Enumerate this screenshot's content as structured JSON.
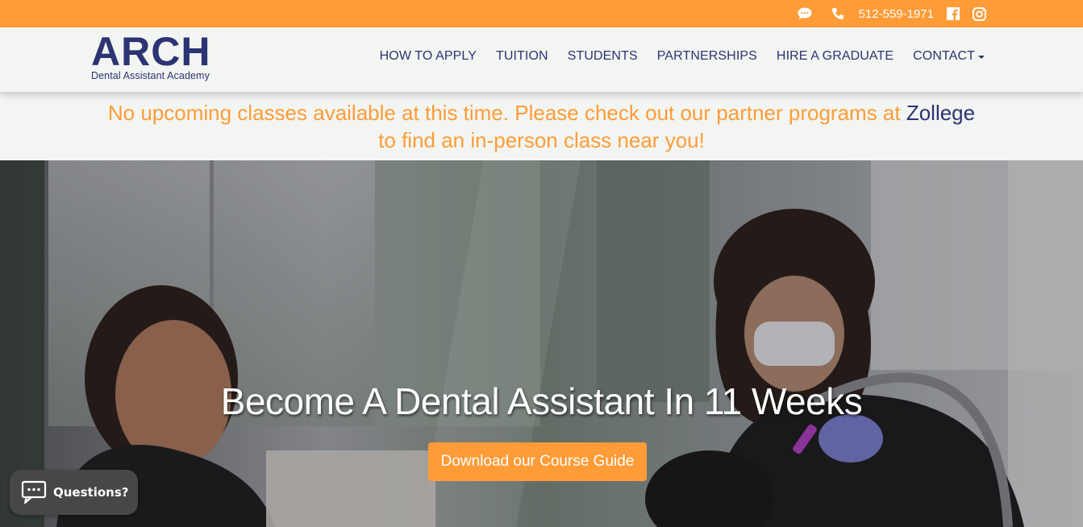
{
  "topbar": {
    "phone": "512-559-1971",
    "icons": [
      "chat-icon",
      "phone-icon",
      "facebook-icon",
      "instagram-icon"
    ]
  },
  "header": {
    "logo_main": "ARCH",
    "logo_sub": "Dental Assistant Academy",
    "nav": [
      {
        "label": "HOW TO APPLY"
      },
      {
        "label": "TUITION"
      },
      {
        "label": "STUDENTS"
      },
      {
        "label": "PARTNERSHIPS"
      },
      {
        "label": "HIRE A GRADUATE"
      },
      {
        "label": "CONTACT"
      }
    ]
  },
  "notice": {
    "text_before": "No upcoming classes available at this time. Please check out our partner programs at ",
    "link": "Zollege",
    "text_after": " to find an in-person class near you!"
  },
  "hero": {
    "title": "Become A Dental Assistant In 11 Weeks",
    "cta": "Download our Course Guide"
  },
  "chat_widget": {
    "label": "Questions?"
  },
  "colors": {
    "accent": "#ff9c38",
    "brand": "#2c3473",
    "header_bg": "#f2f5f1"
  }
}
